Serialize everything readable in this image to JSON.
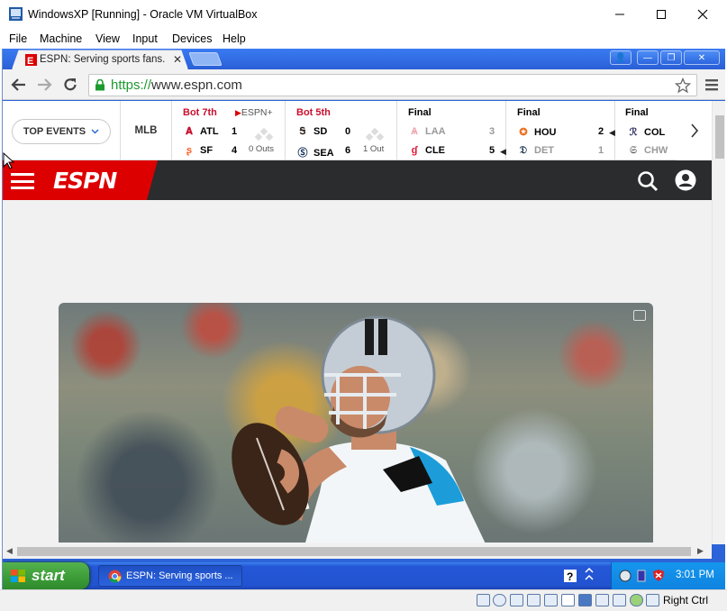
{
  "vbox": {
    "window_title": "WindowsXP [Running] - Oracle VM VirtualBox",
    "menu": [
      "File",
      "Machine",
      "View",
      "Input",
      "Devices",
      "Help"
    ],
    "host_key": "Right Ctrl"
  },
  "browser": {
    "tab_title": "ESPN: Serving sports fans. A",
    "url_scheme": "https://",
    "url_host": "www.espn.com"
  },
  "scoreboard": {
    "top_events_label": "TOP EVENTS",
    "league": "MLB",
    "games": [
      {
        "status": "Bot 7th",
        "network": "ESPN+",
        "outs": "0 Outs",
        "teams": [
          {
            "abbr": "ATL",
            "score": "1"
          },
          {
            "abbr": "SF",
            "score": "4"
          }
        ]
      },
      {
        "status": "Bot 5th",
        "network": "",
        "outs": "1 Out",
        "teams": [
          {
            "abbr": "SD",
            "score": "0"
          },
          {
            "abbr": "SEA",
            "score": "6"
          }
        ]
      },
      {
        "status": "Final",
        "network": "",
        "outs": "",
        "teams": [
          {
            "abbr": "LAA",
            "score": "3"
          },
          {
            "abbr": "CLE",
            "score": "5"
          }
        ]
      },
      {
        "status": "Final",
        "network": "",
        "outs": "",
        "teams": [
          {
            "abbr": "HOU",
            "score": "2"
          },
          {
            "abbr": "DET",
            "score": "1"
          }
        ]
      },
      {
        "status": "Final",
        "network": "",
        "outs": "",
        "teams": [
          {
            "abbr": "COL",
            "score": ""
          },
          {
            "abbr": "CHW",
            "score": ""
          }
        ]
      }
    ]
  },
  "espn": {
    "logo_text": "ESPN"
  },
  "taskbar": {
    "start_label": "start",
    "task_label": "ESPN: Serving sports ...",
    "clock": "3:01 PM"
  },
  "colors": {
    "espn_red": "#dd0000",
    "header_dark": "#2b2c2d",
    "live_status": "#c8102e",
    "xp_taskbar": "#2457d6",
    "xp_start_green": "#3b9b37"
  }
}
